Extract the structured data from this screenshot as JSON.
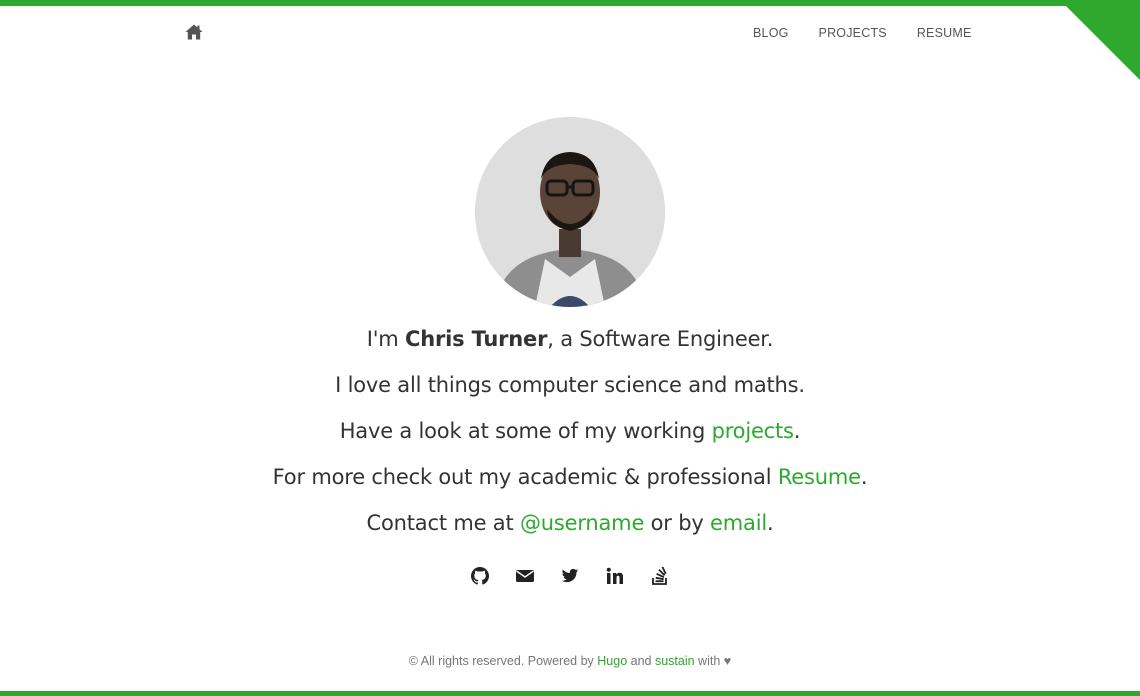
{
  "nav": {
    "home_icon": "home-icon",
    "items": [
      {
        "label": "BLOG"
      },
      {
        "label": "PROJECTS"
      },
      {
        "label": "RESUME"
      }
    ]
  },
  "corner_icon": "github-octocat-corner-icon",
  "intro": {
    "line1_prefix": "I'm ",
    "name": "Chris Turner",
    "line1_suffix": ", a Software Engineer.",
    "line2": "I love all things computer science and maths.",
    "line3_prefix": "Have a look at some of my working ",
    "line3_link": "projects",
    "line3_suffix": ".",
    "line4_prefix": "For more check out my academic & professional ",
    "line4_link": "Resume",
    "line4_suffix": ".",
    "line5_prefix": "Contact me at ",
    "line5_link1": "@username",
    "line5_middle": " or by ",
    "line5_link2": "email",
    "line5_suffix": "."
  },
  "social": [
    "github-icon",
    "envelope-icon",
    "twitter-icon",
    "linkedin-icon",
    "stackoverflow-icon"
  ],
  "footer": {
    "prefix": "© All rights reserved. Powered by ",
    "link1": "Hugo",
    "middle": " and ",
    "link2": "sustain",
    "suffix": " with ",
    "heart": "♥"
  },
  "colors": {
    "accent": "#2fa82f",
    "text": "#333333",
    "muted": "#777777"
  }
}
